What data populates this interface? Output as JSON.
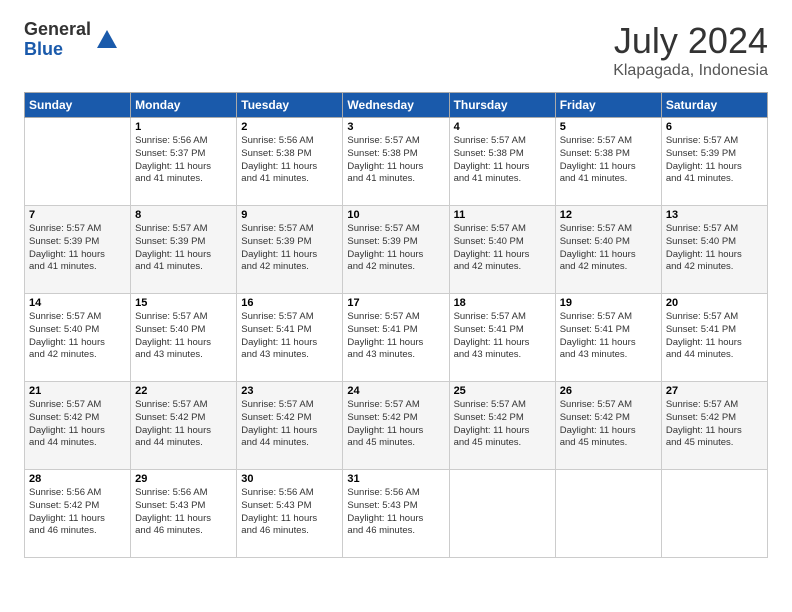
{
  "header": {
    "logo_general": "General",
    "logo_blue": "Blue",
    "month_year": "July 2024",
    "location": "Klapagada, Indonesia"
  },
  "days_of_week": [
    "Sunday",
    "Monday",
    "Tuesday",
    "Wednesday",
    "Thursday",
    "Friday",
    "Saturday"
  ],
  "weeks": [
    [
      {
        "day": "",
        "info": ""
      },
      {
        "day": "1",
        "info": "Sunrise: 5:56 AM\nSunset: 5:37 PM\nDaylight: 11 hours\nand 41 minutes."
      },
      {
        "day": "2",
        "info": "Sunrise: 5:56 AM\nSunset: 5:38 PM\nDaylight: 11 hours\nand 41 minutes."
      },
      {
        "day": "3",
        "info": "Sunrise: 5:57 AM\nSunset: 5:38 PM\nDaylight: 11 hours\nand 41 minutes."
      },
      {
        "day": "4",
        "info": "Sunrise: 5:57 AM\nSunset: 5:38 PM\nDaylight: 11 hours\nand 41 minutes."
      },
      {
        "day": "5",
        "info": "Sunrise: 5:57 AM\nSunset: 5:38 PM\nDaylight: 11 hours\nand 41 minutes."
      },
      {
        "day": "6",
        "info": "Sunrise: 5:57 AM\nSunset: 5:39 PM\nDaylight: 11 hours\nand 41 minutes."
      }
    ],
    [
      {
        "day": "7",
        "info": "Sunrise: 5:57 AM\nSunset: 5:39 PM\nDaylight: 11 hours\nand 41 minutes."
      },
      {
        "day": "8",
        "info": "Sunrise: 5:57 AM\nSunset: 5:39 PM\nDaylight: 11 hours\nand 41 minutes."
      },
      {
        "day": "9",
        "info": "Sunrise: 5:57 AM\nSunset: 5:39 PM\nDaylight: 11 hours\nand 42 minutes."
      },
      {
        "day": "10",
        "info": "Sunrise: 5:57 AM\nSunset: 5:39 PM\nDaylight: 11 hours\nand 42 minutes."
      },
      {
        "day": "11",
        "info": "Sunrise: 5:57 AM\nSunset: 5:40 PM\nDaylight: 11 hours\nand 42 minutes."
      },
      {
        "day": "12",
        "info": "Sunrise: 5:57 AM\nSunset: 5:40 PM\nDaylight: 11 hours\nand 42 minutes."
      },
      {
        "day": "13",
        "info": "Sunrise: 5:57 AM\nSunset: 5:40 PM\nDaylight: 11 hours\nand 42 minutes."
      }
    ],
    [
      {
        "day": "14",
        "info": "Sunrise: 5:57 AM\nSunset: 5:40 PM\nDaylight: 11 hours\nand 42 minutes."
      },
      {
        "day": "15",
        "info": "Sunrise: 5:57 AM\nSunset: 5:40 PM\nDaylight: 11 hours\nand 43 minutes."
      },
      {
        "day": "16",
        "info": "Sunrise: 5:57 AM\nSunset: 5:41 PM\nDaylight: 11 hours\nand 43 minutes."
      },
      {
        "day": "17",
        "info": "Sunrise: 5:57 AM\nSunset: 5:41 PM\nDaylight: 11 hours\nand 43 minutes."
      },
      {
        "day": "18",
        "info": "Sunrise: 5:57 AM\nSunset: 5:41 PM\nDaylight: 11 hours\nand 43 minutes."
      },
      {
        "day": "19",
        "info": "Sunrise: 5:57 AM\nSunset: 5:41 PM\nDaylight: 11 hours\nand 43 minutes."
      },
      {
        "day": "20",
        "info": "Sunrise: 5:57 AM\nSunset: 5:41 PM\nDaylight: 11 hours\nand 44 minutes."
      }
    ],
    [
      {
        "day": "21",
        "info": "Sunrise: 5:57 AM\nSunset: 5:42 PM\nDaylight: 11 hours\nand 44 minutes."
      },
      {
        "day": "22",
        "info": "Sunrise: 5:57 AM\nSunset: 5:42 PM\nDaylight: 11 hours\nand 44 minutes."
      },
      {
        "day": "23",
        "info": "Sunrise: 5:57 AM\nSunset: 5:42 PM\nDaylight: 11 hours\nand 44 minutes."
      },
      {
        "day": "24",
        "info": "Sunrise: 5:57 AM\nSunset: 5:42 PM\nDaylight: 11 hours\nand 45 minutes."
      },
      {
        "day": "25",
        "info": "Sunrise: 5:57 AM\nSunset: 5:42 PM\nDaylight: 11 hours\nand 45 minutes."
      },
      {
        "day": "26",
        "info": "Sunrise: 5:57 AM\nSunset: 5:42 PM\nDaylight: 11 hours\nand 45 minutes."
      },
      {
        "day": "27",
        "info": "Sunrise: 5:57 AM\nSunset: 5:42 PM\nDaylight: 11 hours\nand 45 minutes."
      }
    ],
    [
      {
        "day": "28",
        "info": "Sunrise: 5:56 AM\nSunset: 5:42 PM\nDaylight: 11 hours\nand 46 minutes."
      },
      {
        "day": "29",
        "info": "Sunrise: 5:56 AM\nSunset: 5:43 PM\nDaylight: 11 hours\nand 46 minutes."
      },
      {
        "day": "30",
        "info": "Sunrise: 5:56 AM\nSunset: 5:43 PM\nDaylight: 11 hours\nand 46 minutes."
      },
      {
        "day": "31",
        "info": "Sunrise: 5:56 AM\nSunset: 5:43 PM\nDaylight: 11 hours\nand 46 minutes."
      },
      {
        "day": "",
        "info": ""
      },
      {
        "day": "",
        "info": ""
      },
      {
        "day": "",
        "info": ""
      }
    ]
  ]
}
